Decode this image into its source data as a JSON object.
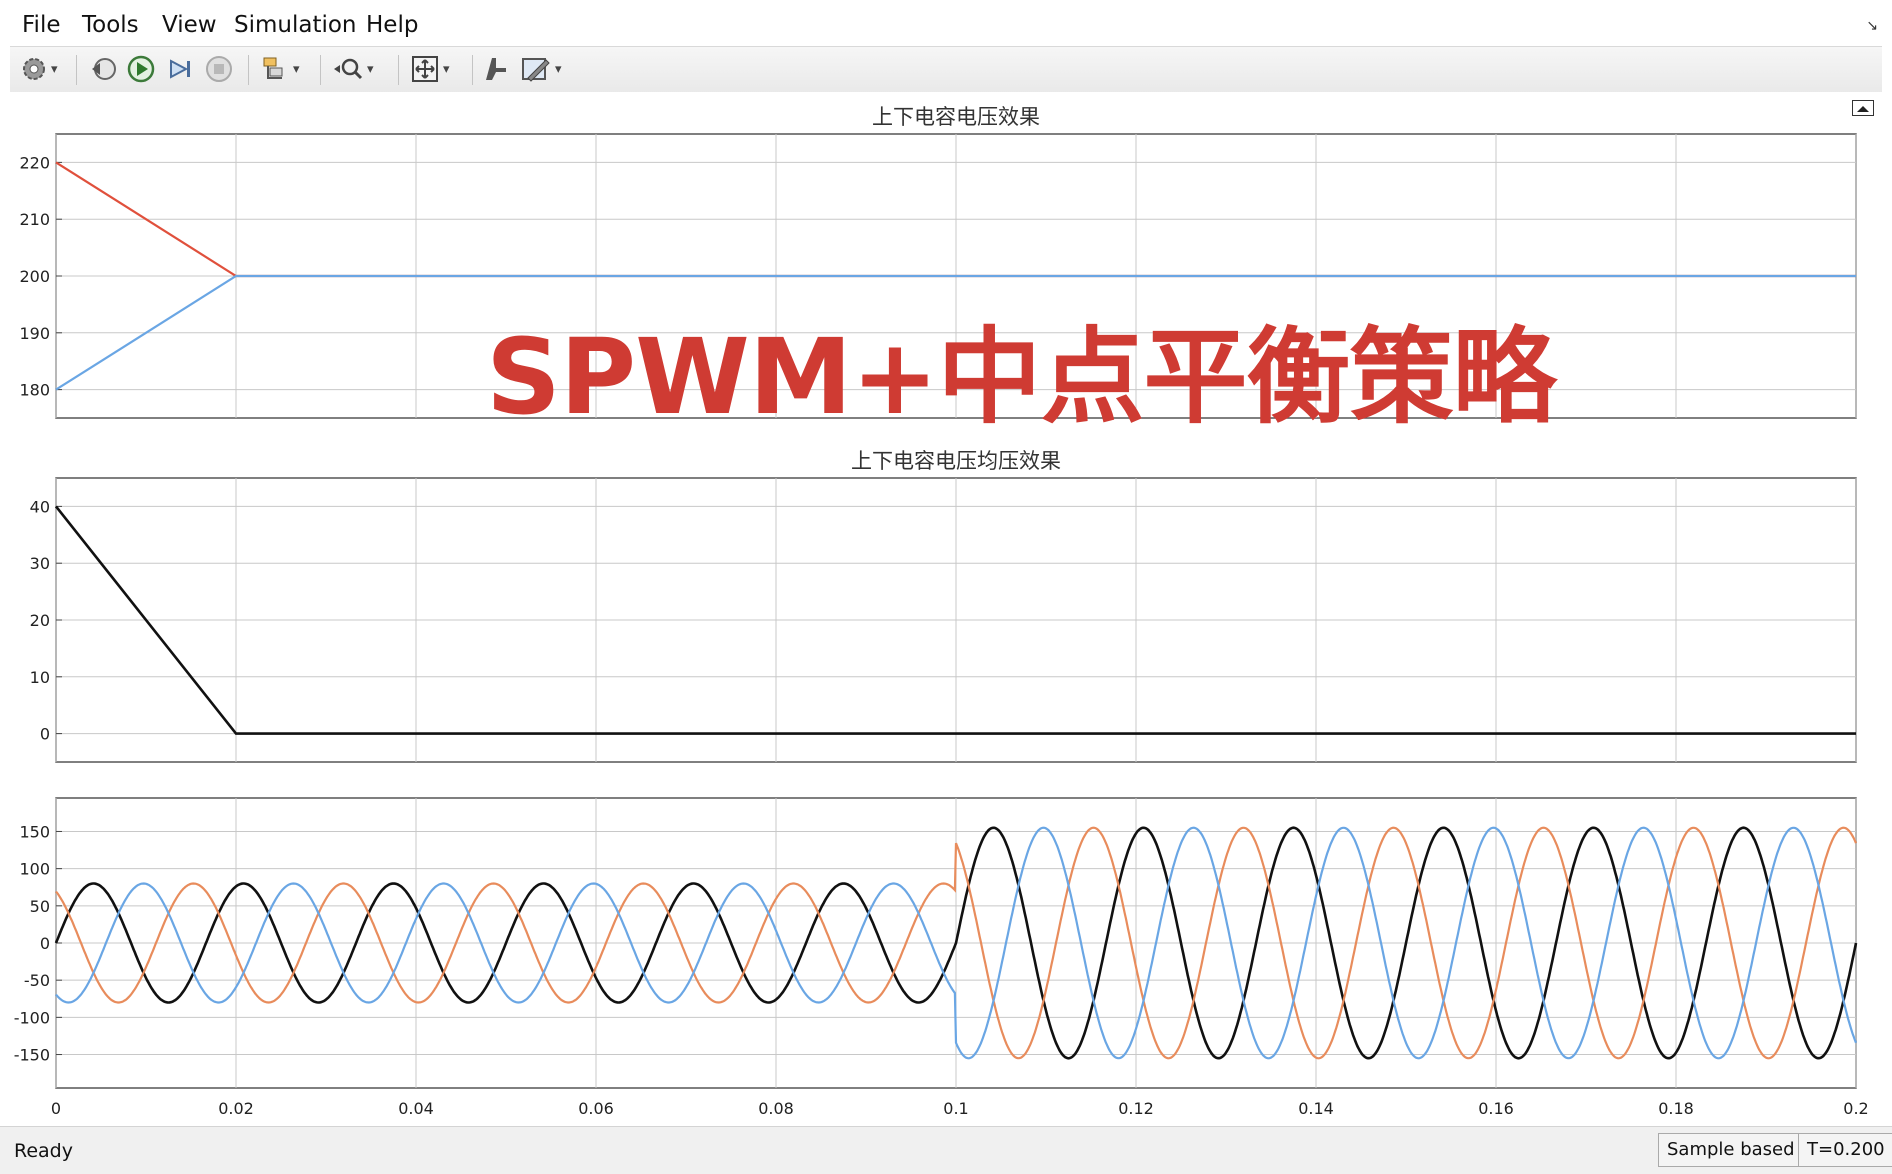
{
  "menu": [
    "File",
    "Tools",
    "View",
    "Simulation",
    "Help"
  ],
  "toolbar_icons": [
    "parameters-gear-icon",
    "step-back-icon",
    "run-icon",
    "step-forward-icon",
    "stop-icon",
    "highlight-icon",
    "zoom-icon",
    "zoom-to-fit-icon",
    "cursor-measurement-icon",
    "style-edit-icon"
  ],
  "overlay_caption": "SPWM+中点平衡策略",
  "status": {
    "ready": "Ready",
    "sample_based": "Sample based",
    "time": "T=0.200"
  },
  "colors": {
    "red": "#e0503c",
    "blue": "#6aa6e4",
    "orange": "#e88c5c",
    "black": "#111111",
    "caption": "#cf3b33",
    "grid": "#c8c8c8"
  },
  "chart_data": [
    {
      "type": "line",
      "title": "上下电容电压效果",
      "xlim": [
        0,
        0.2
      ],
      "ylim": [
        175,
        225
      ],
      "yticks": [
        180,
        190,
        200,
        210,
        220
      ],
      "xticks": [
        0,
        0.02,
        0.04,
        0.06,
        0.08,
        0.1,
        0.12,
        0.14,
        0.16,
        0.18,
        0.2
      ],
      "grid": true,
      "series": [
        {
          "color": "#e0503c",
          "x": [
            0,
            0.02,
            0.2
          ],
          "y": [
            220,
            200,
            200
          ]
        },
        {
          "color": "#6aa6e4",
          "x": [
            0,
            0.02,
            0.2
          ],
          "y": [
            180,
            200,
            200
          ]
        }
      ]
    },
    {
      "type": "line",
      "title": "上下电容电压均压效果",
      "xlim": [
        0,
        0.2
      ],
      "ylim": [
        -5,
        45
      ],
      "yticks": [
        0,
        10,
        20,
        30,
        40
      ],
      "xticks": [
        0,
        0.02,
        0.04,
        0.06,
        0.08,
        0.1,
        0.12,
        0.14,
        0.16,
        0.18,
        0.2
      ],
      "grid": true,
      "series": [
        {
          "color": "#111111",
          "x": [
            0,
            0.02,
            0.2
          ],
          "y": [
            40,
            0,
            0
          ]
        }
      ]
    },
    {
      "type": "line",
      "title": "",
      "xlim": [
        0,
        0.2
      ],
      "ylim": [
        -195,
        195
      ],
      "yticks": [
        150,
        100,
        50,
        0,
        -50,
        -100,
        -150
      ],
      "ytick_labels": [
        "150",
        "100",
        "50",
        "0",
        "-50",
        "-100",
        "-150"
      ],
      "xticks": [
        0,
        0.02,
        0.04,
        0.06,
        0.08,
        0.1,
        0.12,
        0.14,
        0.16,
        0.18,
        0.2
      ],
      "xtick_labels": [
        "0",
        "0.02",
        "0.04",
        "0.06",
        "0.08",
        "0.1",
        "0.12",
        "0.14",
        "0.16",
        "0.18",
        "0.2"
      ],
      "grid": true,
      "series": [
        {
          "color": "#111111",
          "frequency_hz": 60,
          "phase_deg": 0,
          "amplitude_before_0_1": 80,
          "amplitude_after_0_1": 155
        },
        {
          "color": "#e88c5c",
          "frequency_hz": 60,
          "phase_deg": 120,
          "amplitude_before_0_1": 80,
          "amplitude_after_0_1": 155
        },
        {
          "color": "#6aa6e4",
          "frequency_hz": 60,
          "phase_deg": -120,
          "amplitude_before_0_1": 80,
          "amplitude_after_0_1": 155
        }
      ]
    }
  ]
}
